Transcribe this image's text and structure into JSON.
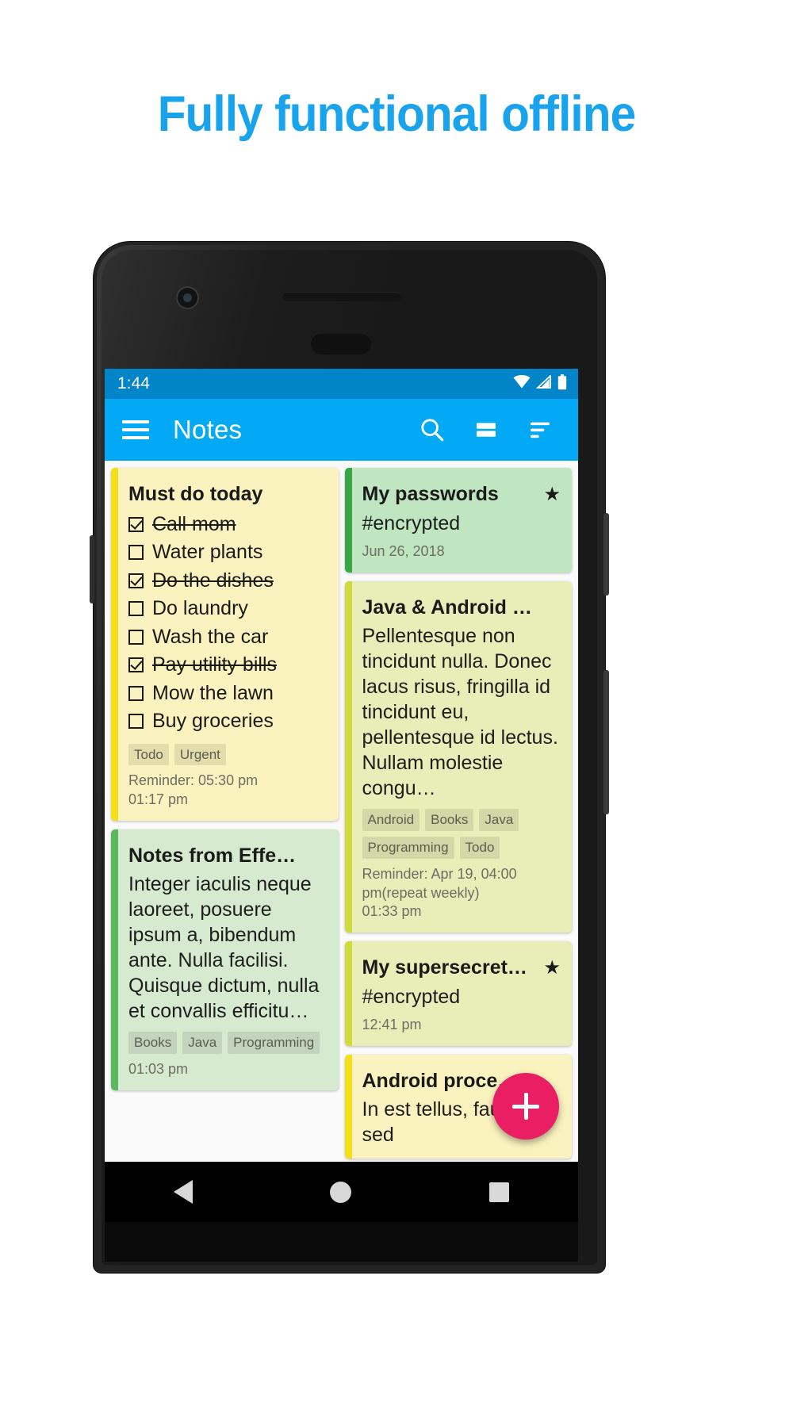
{
  "headline": "Fully functional offline",
  "accent_color": "#18a3ec",
  "app": {
    "statusbar": {
      "clock": "1:44",
      "icons": [
        "wifi-icon",
        "signal-icon",
        "battery-icon"
      ]
    },
    "appbar": {
      "menu_icon": "hamburger-menu-icon",
      "title": "Notes",
      "actions": [
        "search-icon",
        "view-mode-icon",
        "sort-icon"
      ]
    },
    "fab": {
      "label": "+",
      "name": "add-note-button",
      "color": "#e91e63"
    },
    "navbar": {
      "back": "back-triangle-icon",
      "home": "home-circle-icon",
      "recents": "recents-square-icon"
    }
  },
  "notes": {
    "must_do_today": {
      "title": "Must do today",
      "accent": "#f4e019",
      "background": "#faf3bf",
      "items": [
        {
          "label": "Call mom",
          "checked": true
        },
        {
          "label": "Water plants",
          "checked": false
        },
        {
          "label": "Do the dishes",
          "checked": true
        },
        {
          "label": "Do laundry",
          "checked": false
        },
        {
          "label": "Wash the car",
          "checked": false
        },
        {
          "label": "Pay utility bills",
          "checked": true
        },
        {
          "label": "Mow the lawn",
          "checked": false
        },
        {
          "label": "Buy groceries",
          "checked": false
        }
      ],
      "tags": [
        "Todo",
        "Urgent"
      ],
      "reminder": "Reminder: 05:30 pm",
      "time": "01:17 pm"
    },
    "notes_from_effe": {
      "title": "Notes from Effe…",
      "accent": "#5cb85c",
      "background": "#d6ead0",
      "body": "Integer iaculis neque laoreet, posuere ipsum a, bibendum ante. Nulla facilisi. Quisque dictum, nulla et convallis efficitu…",
      "tags": [
        "Books",
        "Java",
        "Programming"
      ],
      "time": "01:03 pm"
    },
    "my_passwords": {
      "title": "My passwords",
      "accent": "#3aa545",
      "background": "#bfe6c0",
      "sub": "#encrypted",
      "date": "Jun 26, 2018",
      "starred": true,
      "star_glyph": "★"
    },
    "java_android": {
      "title": "Java & Android …",
      "accent": "#cddc39",
      "background": "#e9eeb8",
      "body": "Pellentesque non tincidunt nulla. Donec lacus risus, fringilla id tincidunt eu, pellentesque id lectus. Nullam molestie congu…",
      "tags": [
        "Android",
        "Books",
        "Java",
        "Programming",
        "Todo"
      ],
      "reminder": "Reminder: Apr 19, 04:00 pm(repeat weekly)",
      "time": "01:33 pm"
    },
    "my_supersecret": {
      "title": "My supersecret…",
      "accent": "#cddc39",
      "background": "#e9eeb8",
      "sub": "#encrypted",
      "time": "12:41 pm",
      "starred": true,
      "star_glyph": "★"
    },
    "android_proce": {
      "title": "Android proce…",
      "accent": "#f4e019",
      "background": "#faf3bf",
      "body": "In est tellus, faucibus sed"
    }
  }
}
